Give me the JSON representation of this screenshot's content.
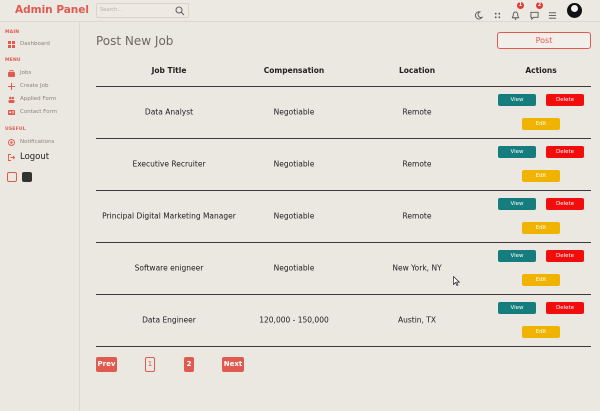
{
  "app": {
    "title": "Admin Panel"
  },
  "header": {
    "search_placeholder": "Search...",
    "notifications_count": "1",
    "messages_count": "2"
  },
  "sidebar": {
    "sections": [
      {
        "title": "MAIN",
        "items": [
          {
            "label": "Dashboard",
            "icon": "dashboard-icon"
          }
        ]
      },
      {
        "title": "MENU",
        "items": [
          {
            "label": "Jobs",
            "icon": "briefcase-icon"
          },
          {
            "label": "Create Job",
            "icon": "plus-icon"
          },
          {
            "label": "Applied Form",
            "icon": "users-icon"
          },
          {
            "label": "Contact Form",
            "icon": "contact-card-icon"
          }
        ]
      },
      {
        "title": "USEFUL",
        "items": [
          {
            "label": "Notifications",
            "icon": "notification-icon"
          },
          {
            "label": "Logout",
            "icon": "logout-icon"
          }
        ]
      }
    ],
    "theme_colors": [
      "#ebe7e1",
      "#333333"
    ]
  },
  "main": {
    "title": "Post New Job",
    "post_button": "Post",
    "columns": [
      "Job Title",
      "Compensation",
      "Location",
      "Actions"
    ],
    "rows": [
      {
        "title": "Data Analyst",
        "compensation": "Negotiable",
        "location": "Remote"
      },
      {
        "title": "Executive Recruiter",
        "compensation": "Negotiable",
        "location": "Remote"
      },
      {
        "title": "Principal Digital Marketing Manager",
        "compensation": "Negotiable",
        "location": "Remote"
      },
      {
        "title": "Software enigneer",
        "compensation": "Negotiable",
        "location": "New York, NY"
      },
      {
        "title": "Data Engineer",
        "compensation": "120,000 - 150,000",
        "location": "Austin, TX"
      }
    ],
    "actions": {
      "view": "View",
      "delete": "Delete",
      "edit": "Edit"
    }
  },
  "pagination": {
    "prev": "Prev",
    "pages": [
      "1",
      "2"
    ],
    "next": "Next"
  },
  "colors": {
    "accent": "#e05a4f",
    "view": "#167d7f",
    "delete": "#f20d0d",
    "edit": "#f0b400",
    "background": "#ebe7e1"
  }
}
